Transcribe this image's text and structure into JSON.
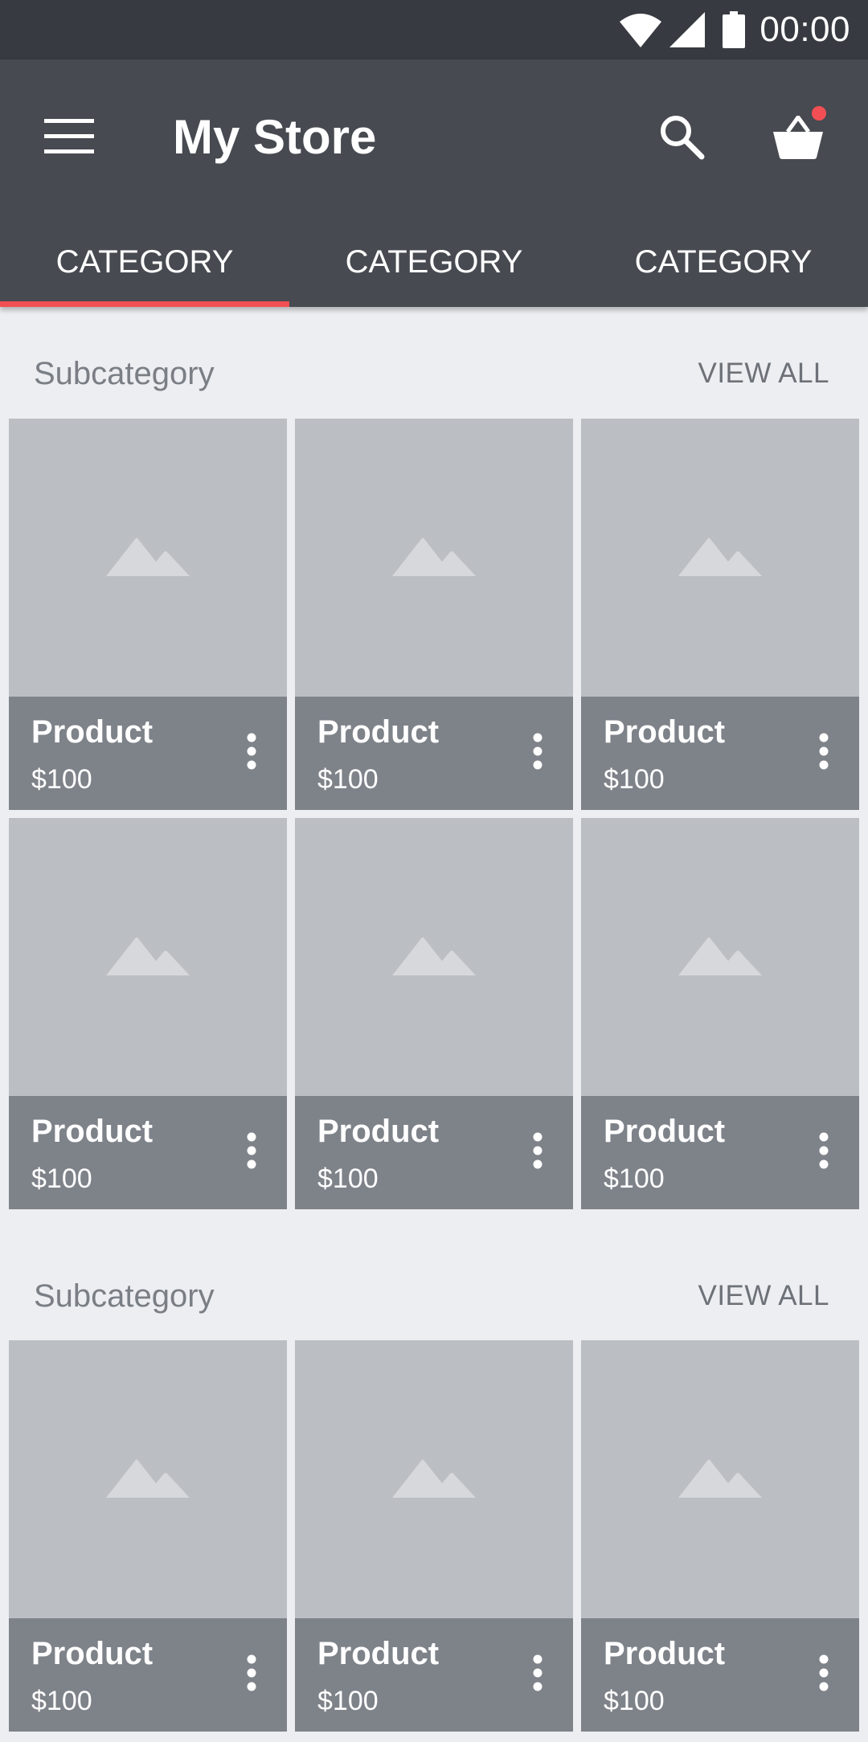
{
  "status_bar": {
    "time": "00:00",
    "icons": [
      "wifi-icon",
      "signal-icon",
      "battery-icon"
    ]
  },
  "app_bar": {
    "title": "My Store",
    "menu_icon": "menu-icon",
    "search_icon": "search-icon",
    "cart_icon": "basket-icon",
    "cart_badge_color": "#f24f54"
  },
  "tabs": [
    {
      "label": "CATEGORY",
      "active": true
    },
    {
      "label": "CATEGORY",
      "active": false
    },
    {
      "label": "CATEGORY",
      "active": false
    }
  ],
  "sections": [
    {
      "title": "Subcategory",
      "view_all": "VIEW ALL",
      "products": [
        {
          "name": "Product",
          "price": "$100"
        },
        {
          "name": "Product",
          "price": "$100"
        },
        {
          "name": "Product",
          "price": "$100"
        },
        {
          "name": "Product",
          "price": "$100"
        },
        {
          "name": "Product",
          "price": "$100"
        },
        {
          "name": "Product",
          "price": "$100"
        }
      ]
    },
    {
      "title": "Subcategory",
      "view_all": "VIEW ALL",
      "products": [
        {
          "name": "Product",
          "price": "$100"
        },
        {
          "name": "Product",
          "price": "$100"
        },
        {
          "name": "Product",
          "price": "$100"
        }
      ]
    }
  ],
  "colors": {
    "status_bar": "#373a40",
    "app_bar": "#474a50",
    "accent": "#f24f54",
    "background": "#eceef1",
    "card_image": "#bbbec2",
    "card_footer": "#7e8289"
  }
}
